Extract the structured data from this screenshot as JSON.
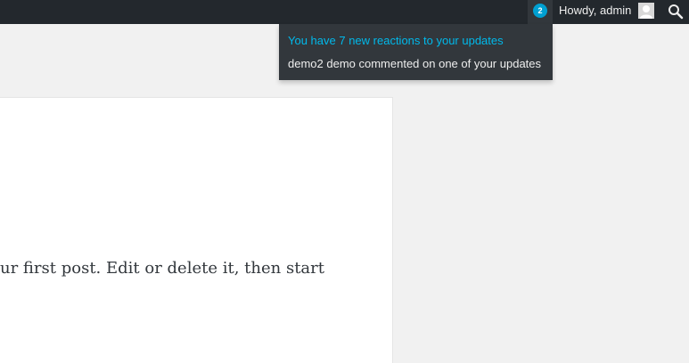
{
  "admin_bar": {
    "notification_count": "2",
    "greeting": "Howdy, admin",
    "icons": {
      "avatar": "avatar-icon",
      "search": "search-icon"
    }
  },
  "notifications": {
    "items": [
      {
        "text": "You have 7 new reactions to your updates",
        "color": "#00b9eb"
      },
      {
        "text": "demo2 demo commented on one of your updates",
        "color": "#eeeeee"
      }
    ]
  },
  "post": {
    "excerpt": "ur first post. Edit or delete it, then start"
  }
}
